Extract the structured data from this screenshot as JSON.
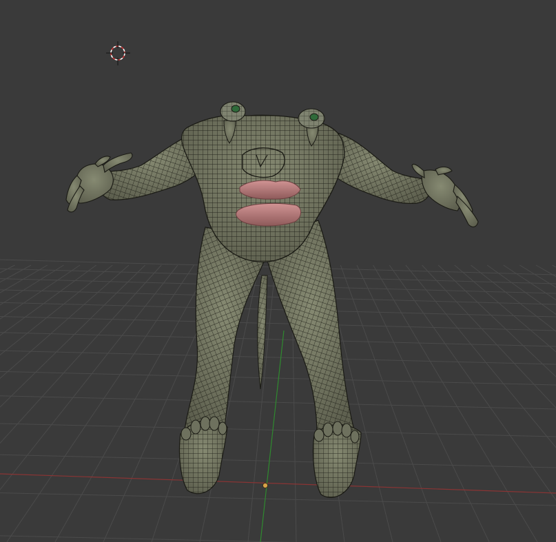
{
  "viewport": {
    "kind": "3D viewport (perspective, wireframe-over-solid mesh)",
    "background": "#3a3a3a",
    "grid_color": "#4b4b4b",
    "x_axis_color": "#8a3434",
    "y_axis_color": "#2f8a2f",
    "origin_color": "#d8a24a"
  },
  "cursor3d": {
    "icon": "3d-cursor-icon",
    "ring_color_a": "#ffffff",
    "ring_color_b": "#d23a3a",
    "crosshair_color": "#111111"
  },
  "mesh": {
    "object": "creature-body-mesh",
    "skin_color": "#7d8069",
    "skin_shadow_color": "#5b5d4c",
    "wire_color": "#1a1a14",
    "lips_color": "#c28484",
    "lips_shadow_color": "#8e5a5a",
    "eye_color": "#2f6a3a",
    "parts": [
      "torso",
      "left-arm",
      "right-arm",
      "left-hand",
      "right-hand",
      "left-leg",
      "right-leg",
      "left-foot",
      "right-foot",
      "left-eye-stalk",
      "right-eye-stalk",
      "upper-lip",
      "lower-lip",
      "tail"
    ]
  }
}
